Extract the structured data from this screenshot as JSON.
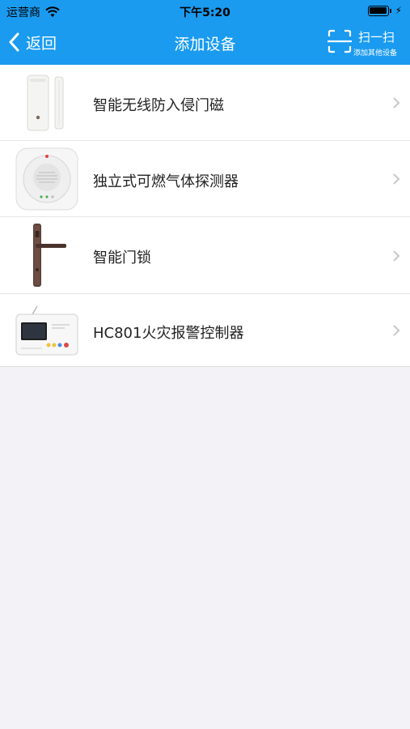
{
  "status_bar": {
    "carrier": "运营商",
    "time": "下午5:20"
  },
  "nav": {
    "back_label": "返回",
    "title": "添加设备",
    "scan_label": "扫一扫",
    "scan_sublabel": "添加其他设备"
  },
  "devices": [
    {
      "label": "智能无线防入侵门磁",
      "icon": "door-sensor-icon"
    },
    {
      "label": "独立式可燃气体探测器",
      "icon": "gas-detector-icon"
    },
    {
      "label": "智能门锁",
      "icon": "door-lock-icon"
    },
    {
      "label": "HC801火灾报警控制器",
      "icon": "fire-alarm-panel-icon"
    }
  ],
  "colors": {
    "header": "#1a9bf0",
    "background": "#f2f2f7"
  }
}
